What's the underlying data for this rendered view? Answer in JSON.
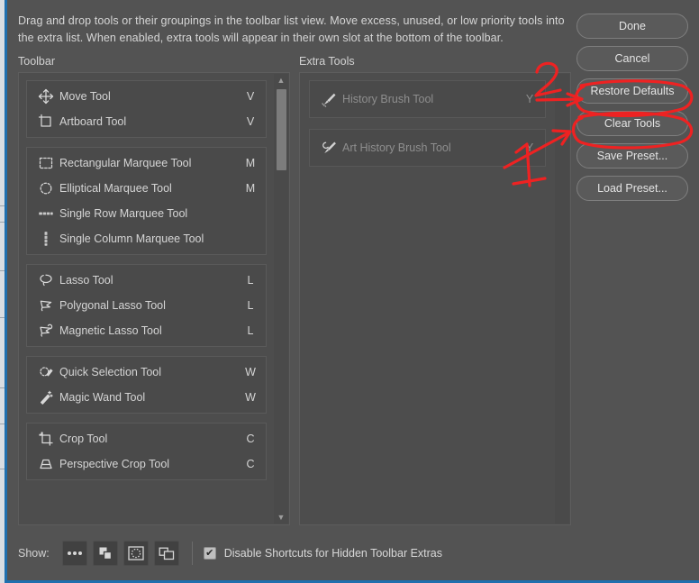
{
  "header": {
    "description": "Drag and drop tools or their groupings in the toolbar list view. Move excess, unused, or low priority tools into the extra list. When enabled, extra tools will appear in their own slot at the bottom of the toolbar."
  },
  "columns": {
    "toolbar_label": "Toolbar",
    "extra_label": "Extra Tools"
  },
  "toolbar_groups": [
    {
      "tools": [
        {
          "icon": "move-tool-icon",
          "name": "Move Tool",
          "shortcut": "V"
        },
        {
          "icon": "artboard-tool-icon",
          "name": "Artboard Tool",
          "shortcut": "V"
        }
      ]
    },
    {
      "tools": [
        {
          "icon": "rectangular-marquee-tool-icon",
          "name": "Rectangular Marquee Tool",
          "shortcut": "M"
        },
        {
          "icon": "elliptical-marquee-tool-icon",
          "name": "Elliptical Marquee Tool",
          "shortcut": "M"
        },
        {
          "icon": "single-row-marquee-tool-icon",
          "name": "Single Row Marquee Tool",
          "shortcut": ""
        },
        {
          "icon": "single-column-marquee-tool-icon",
          "name": "Single Column Marquee Tool",
          "shortcut": ""
        }
      ]
    },
    {
      "tools": [
        {
          "icon": "lasso-tool-icon",
          "name": "Lasso Tool",
          "shortcut": "L"
        },
        {
          "icon": "polygonal-lasso-tool-icon",
          "name": "Polygonal Lasso Tool",
          "shortcut": "L"
        },
        {
          "icon": "magnetic-lasso-tool-icon",
          "name": "Magnetic Lasso Tool",
          "shortcut": "L"
        }
      ]
    },
    {
      "tools": [
        {
          "icon": "quick-selection-tool-icon",
          "name": "Quick Selection Tool",
          "shortcut": "W"
        },
        {
          "icon": "magic-wand-tool-icon",
          "name": "Magic Wand Tool",
          "shortcut": "W"
        }
      ]
    },
    {
      "tools": [
        {
          "icon": "crop-tool-icon",
          "name": "Crop Tool",
          "shortcut": "C"
        },
        {
          "icon": "perspective-crop-tool-icon",
          "name": "Perspective Crop Tool",
          "shortcut": "C"
        }
      ]
    }
  ],
  "extra_tools": [
    {
      "icon": "history-brush-tool-icon",
      "name": "History Brush Tool",
      "shortcut": "Y"
    },
    {
      "icon": "art-history-brush-tool-icon",
      "name": "Art History Brush Tool",
      "shortcut": "Y"
    }
  ],
  "buttons": {
    "done": "Done",
    "cancel": "Cancel",
    "restore_defaults": "Restore Defaults",
    "clear_tools": "Clear Tools",
    "save_preset": "Save Preset...",
    "load_preset": "Load Preset..."
  },
  "footer": {
    "show_label": "Show:",
    "toggles": [
      {
        "icon": "ellipsis-icon",
        "title": "Show extra tools"
      },
      {
        "icon": "foreground-background-color-icon",
        "title": "Show foreground and background colors"
      },
      {
        "icon": "quick-mask-icon",
        "title": "Show quick mask mode"
      },
      {
        "icon": "screen-mode-icon",
        "title": "Show screen mode"
      }
    ],
    "checkbox": {
      "label": "Disable Shortcuts for Hidden Toolbar Extras",
      "checked": true
    }
  },
  "annotations": [
    {
      "label": "2",
      "target": "restore-defaults-button"
    },
    {
      "label": "1",
      "target": "clear-tools-button"
    }
  ],
  "colors": {
    "dialog_bg": "#535353",
    "panel_bg": "#4d4d4d",
    "group_bg": "#4a4a4a",
    "text": "#d5d5d5",
    "dimmed_text": "#8e8e8e",
    "annotation": "#ee2222"
  }
}
